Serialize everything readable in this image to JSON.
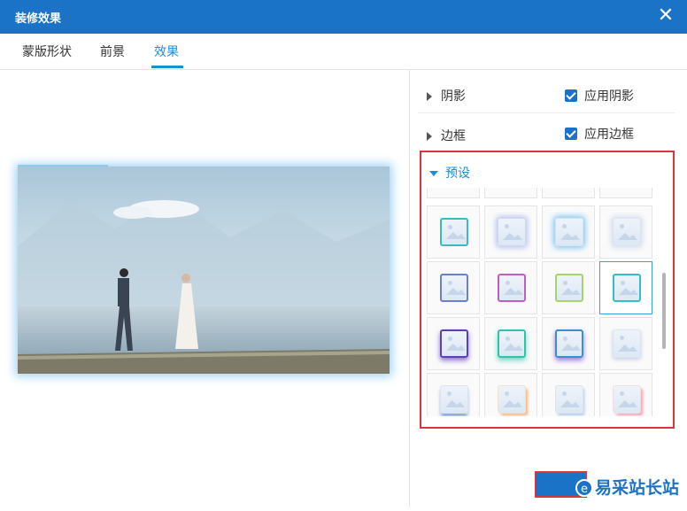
{
  "dialog": {
    "title": "装修效果",
    "close_glyph": "✕"
  },
  "tabs": [
    {
      "label": "蒙版形状"
    },
    {
      "label": "前景"
    },
    {
      "label": "效果",
      "active": true
    }
  ],
  "sections": {
    "shadow": {
      "label": "阴影",
      "checkbox_label": "应用阴影",
      "checked": true
    },
    "border": {
      "label": "边框",
      "checkbox_label": "应用边框",
      "checked": true
    },
    "preset": {
      "label": "预设",
      "expanded": true
    }
  },
  "presets": [
    {
      "style": "plain"
    },
    {
      "style": "teal-frame"
    },
    {
      "style": "soft-blue-glow"
    },
    {
      "style": "blue-glow"
    },
    {
      "style": "light-glow"
    },
    {
      "style": "blue-purple-frame"
    },
    {
      "style": "purple-pink-frame"
    },
    {
      "style": "green-yellow-frame"
    },
    {
      "style": "teal-frame-selected",
      "selected": true
    },
    {
      "style": "purple-shadow"
    },
    {
      "style": "teal-shadow"
    },
    {
      "style": "teal-purple-shadow"
    },
    {
      "style": "soft-shadow"
    },
    {
      "style": "blue-bottom-shadow"
    },
    {
      "style": "orange-edge"
    },
    {
      "style": "light-blue-edge"
    },
    {
      "style": "pink-edge"
    }
  ],
  "colors": {
    "accent": "#1a73c6",
    "active_tab": "#1a8fd6",
    "highlight_box": "#d9363e"
  },
  "watermark": {
    "text": "易采站长站"
  }
}
